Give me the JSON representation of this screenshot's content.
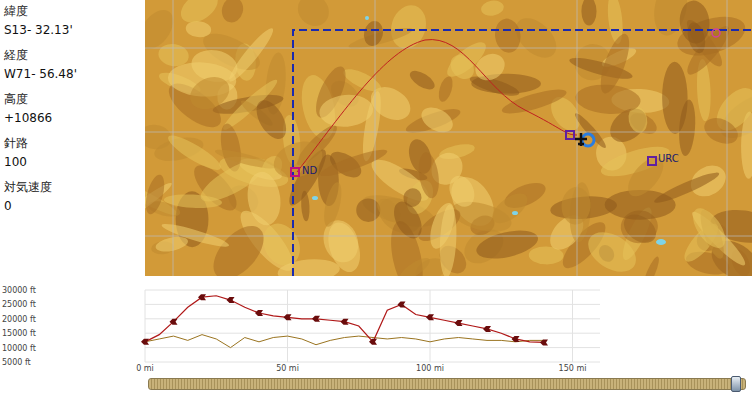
{
  "readouts": [
    {
      "label": "緯度",
      "value": "S13- 32.13'"
    },
    {
      "label": "経度",
      "value": "W71- 56.48'"
    },
    {
      "label": "高度",
      "value": "+10866"
    },
    {
      "label": "針路",
      "value": "100"
    },
    {
      "label": "対気速度",
      "value": "0"
    }
  ],
  "map": {
    "waypoints": [
      {
        "label": "ND"
      },
      {
        "label": "URC"
      }
    ]
  },
  "profile": {
    "y_ticks": [
      "30000 ft",
      "25000 ft",
      "20000 ft",
      "15000 ft",
      "10000 ft",
      "5000 ft"
    ],
    "x_ticks": [
      "0 mi",
      "50 mi",
      "100 mi",
      "150 mi"
    ],
    "altitude": [
      12000,
      14500,
      19000,
      24000,
      27500,
      28000,
      26500,
      24000,
      22000,
      21000,
      20500,
      20000,
      20000,
      19500,
      19000,
      17500,
      12000,
      23000,
      25000,
      21500,
      20500,
      19500,
      18500,
      17500,
      16500,
      15000,
      13000,
      12000,
      11800
    ],
    "terrain": [
      12000,
      13000,
      14000,
      12500,
      14500,
      13000,
      10000,
      13500,
      12000,
      13500,
      14000,
      13000,
      11000,
      12500,
      13500,
      14000,
      13500,
      13000,
      13500,
      13000,
      12000,
      13000,
      13500,
      13000,
      12500,
      12500,
      12000,
      12500,
      12500
    ]
  },
  "timeline": {
    "level": 0.985
  }
}
